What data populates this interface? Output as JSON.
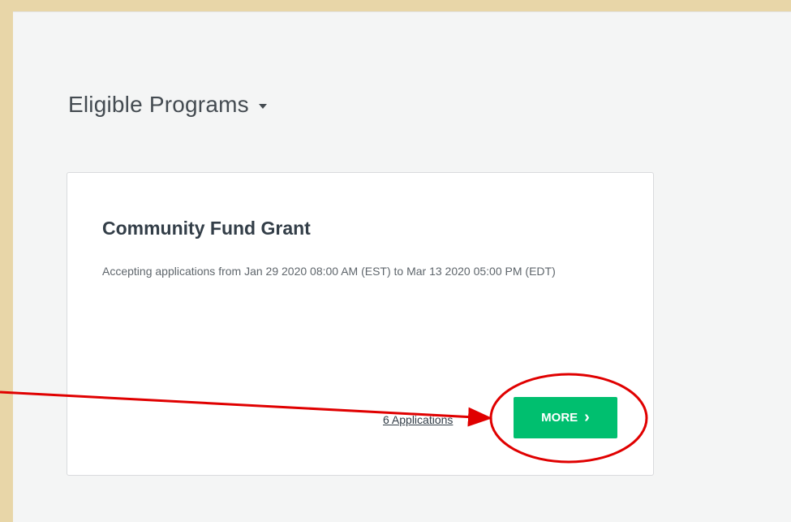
{
  "section": {
    "title": "Eligible Programs",
    "caret_icon": "caret-down-icon"
  },
  "program_card": {
    "title": "Community Fund Grant",
    "description": "Accepting applications from Jan 29 2020 08:00 AM (EST) to Mar 13 2020 05:00 PM (EDT)",
    "applications_link": "6 Applications",
    "more_button_label": "MORE",
    "more_button_icon": "chevron-right-icon"
  },
  "colors": {
    "frame_background": "#e8d6a8",
    "page_background": "#f4f5f5",
    "accent_green": "#00bf6f",
    "annotation_red": "#e00000"
  }
}
